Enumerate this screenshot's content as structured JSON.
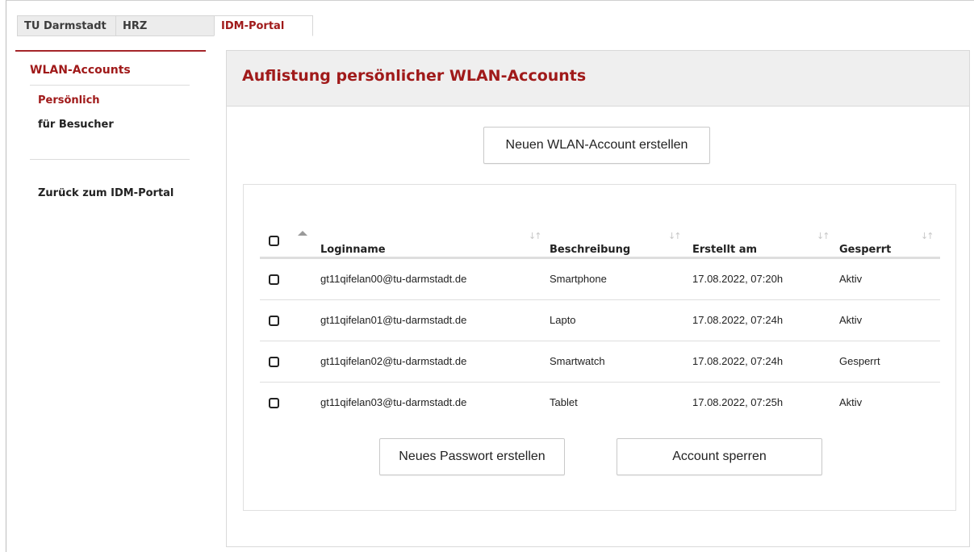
{
  "breadcrumb": [
    "TU Darmstadt",
    "HRZ",
    "IDM-Portal"
  ],
  "sidebar": {
    "title": "WLAN-Accounts",
    "items": [
      {
        "label": "Persönlich",
        "selected": true
      },
      {
        "label": "für Besucher",
        "selected": false
      }
    ],
    "back_label": "Zurück zum IDM-Portal"
  },
  "main": {
    "title": "Auflistung persönlicher WLAN-Accounts",
    "new_account_label": "Neuen WLAN-Account erstellen",
    "columns": [
      "Loginname",
      "Beschreibung",
      "Erstellt am",
      "Gesperrt"
    ],
    "rows": [
      {
        "login": "gt11qifelan00@tu-darmstadt.de",
        "desc": "Smartphone",
        "date": "17.08.2022, 07:20h",
        "status": "Aktiv"
      },
      {
        "login": "gt11qifelan01@tu-darmstadt.de",
        "desc": "Lapto",
        "date": "17.08.2022, 07:24h",
        "status": "Aktiv"
      },
      {
        "login": "gt11qifelan02@tu-darmstadt.de",
        "desc": "Smartwatch",
        "date": "17.08.2022, 07:24h",
        "status": "Gesperrt"
      },
      {
        "login": "gt11qifelan03@tu-darmstadt.de",
        "desc": "Tablet",
        "date": "17.08.2022, 07:25h",
        "status": "Aktiv"
      }
    ],
    "new_password_label": "Neues Passwort erstellen",
    "lock_account_label": "Account sperren"
  },
  "colors": {
    "accent": "#a01a1a",
    "header_bg": "#efefef"
  }
}
